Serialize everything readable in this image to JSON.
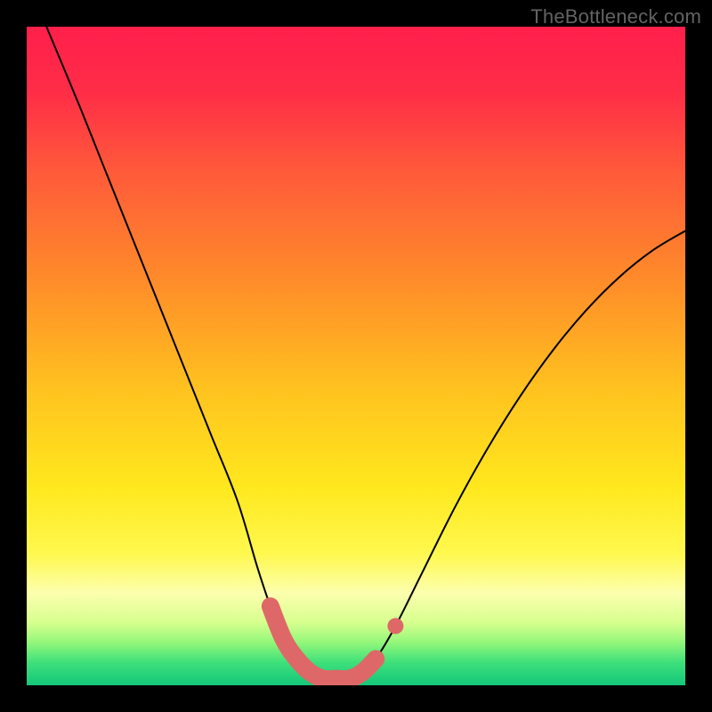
{
  "credit": "TheBottleneck.com",
  "chart_data": {
    "type": "line",
    "title": "",
    "xlabel": "",
    "ylabel": "",
    "xlim": [
      0,
      100
    ],
    "ylim": [
      0,
      100
    ],
    "series": [
      {
        "name": "curve",
        "x": [
          3,
          8,
          12,
          16,
          20,
          24,
          28,
          32,
          35,
          37,
          39,
          41,
          43,
          45,
          47,
          49,
          51,
          53,
          56,
          60,
          65,
          70,
          75,
          80,
          85,
          90,
          95,
          100
        ],
        "values": [
          100,
          88,
          78,
          68,
          58,
          48,
          38,
          28,
          18,
          12,
          7,
          4,
          2,
          1,
          1,
          1,
          2,
          4,
          9,
          17,
          27,
          36,
          44,
          51,
          57,
          62,
          66,
          69
        ]
      }
    ],
    "highlight_segment": {
      "x": [
        37,
        39,
        41,
        43,
        45,
        47,
        49,
        51,
        53
      ],
      "values": [
        12,
        7,
        4,
        2,
        1,
        1,
        1,
        2,
        4
      ]
    },
    "highlight_marker": {
      "x": 56,
      "value": 9
    },
    "background_gradient": {
      "stops": [
        {
          "pos": 0.0,
          "color": "#ff1f4b"
        },
        {
          "pos": 0.1,
          "color": "#ff2d47"
        },
        {
          "pos": 0.22,
          "color": "#ff5a3a"
        },
        {
          "pos": 0.38,
          "color": "#ff8a2a"
        },
        {
          "pos": 0.55,
          "color": "#ffc21f"
        },
        {
          "pos": 0.7,
          "color": "#ffe81e"
        },
        {
          "pos": 0.8,
          "color": "#fff84e"
        },
        {
          "pos": 0.86,
          "color": "#fcffae"
        },
        {
          "pos": 0.905,
          "color": "#d6ff8e"
        },
        {
          "pos": 0.935,
          "color": "#93f77a"
        },
        {
          "pos": 0.965,
          "color": "#3fe07a"
        },
        {
          "pos": 1.0,
          "color": "#13c77a"
        }
      ]
    },
    "colors": {
      "curve": "#000000",
      "highlight": "#de6868"
    }
  }
}
